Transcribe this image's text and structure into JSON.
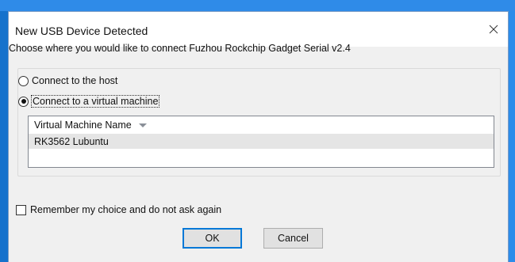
{
  "dialog": {
    "title": "New USB Device Detected",
    "close_icon": "close-icon",
    "prompt": "Choose where you would like to connect Fuzhou Rockchip Gadget Serial v2.4",
    "options": {
      "host_label": "Connect to the host",
      "host_selected": false,
      "vm_label": "Connect to a virtual machine",
      "vm_selected": true
    },
    "vm_list": {
      "column_header": "Virtual Machine Name",
      "sort_icon": "sort-down-arrow-icon",
      "rows": [
        {
          "name": "RK3562 Lubuntu"
        }
      ]
    },
    "remember": {
      "label": "Remember my choice and do not ask again",
      "checked": false
    },
    "buttons": {
      "ok_label": "OK",
      "cancel_label": "Cancel"
    }
  },
  "colors": {
    "desktop_accent": "#2f8be8",
    "dialog_background": "#f0f0f0",
    "title_bar": "#ffffff",
    "default_button_border": "#0078d7",
    "list_row_highlight": "#e5e5e5"
  }
}
